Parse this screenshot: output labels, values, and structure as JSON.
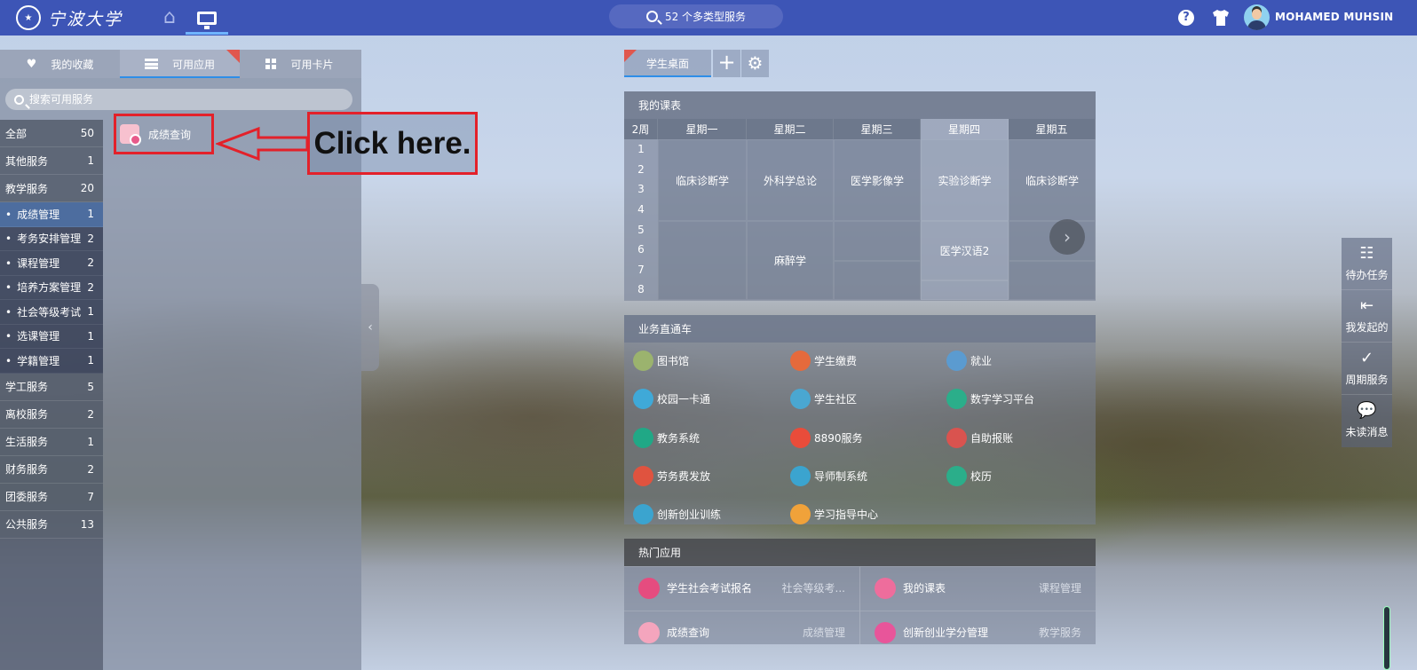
{
  "header": {
    "logo_text": "宁波大学",
    "search_label": "52 个多类型服务",
    "username": "MOHAMED MUHSIN",
    "help_glyph": "?"
  },
  "left_panel": {
    "tabs": [
      {
        "label": "我的收藏",
        "icon": "heart-icon"
      },
      {
        "label": "可用应用",
        "icon": "list-icon"
      },
      {
        "label": "可用卡片",
        "icon": "grid-icon"
      }
    ],
    "search_placeholder": "搜索可用服务",
    "categories": [
      {
        "label": "全部",
        "count": "50"
      },
      {
        "label": "其他服务",
        "count": "1"
      },
      {
        "label": "教学服务",
        "count": "20"
      }
    ],
    "subcategories": [
      {
        "label": "成绩管理",
        "count": "1"
      },
      {
        "label": "考务安排管理",
        "count": "2"
      },
      {
        "label": "课程管理",
        "count": "2"
      },
      {
        "label": "培养方案管理",
        "count": "2"
      },
      {
        "label": "社会等级考试",
        "count": "1"
      },
      {
        "label": "选课管理",
        "count": "1"
      },
      {
        "label": "学籍管理",
        "count": "1"
      }
    ],
    "categories_after": [
      {
        "label": "学工服务",
        "count": "5"
      },
      {
        "label": "离校服务",
        "count": "2"
      },
      {
        "label": "生活服务",
        "count": "1"
      },
      {
        "label": "财务服务",
        "count": "2"
      },
      {
        "label": "团委服务",
        "count": "7"
      },
      {
        "label": "公共服务",
        "count": "13"
      }
    ],
    "app_item": "成绩查询",
    "collapse_glyph": "‹",
    "subcategory_bullet": "•"
  },
  "annotation": {
    "text": "Click here."
  },
  "desk": {
    "tab": "学生桌面",
    "add_glyph": "+",
    "gear_glyph": "⚙"
  },
  "timetable": {
    "title": "我的课表",
    "week": "2周",
    "days": [
      "星期一",
      "星期二",
      "星期三",
      "星期四",
      "星期五"
    ],
    "periods": [
      "1",
      "2",
      "3",
      "4",
      "5",
      "6",
      "7",
      "8"
    ],
    "courses": {
      "mon1": "临床诊断学",
      "tue1": "外科学总论",
      "wed1": "医学影像学",
      "thu1": "实验诊断学",
      "fri1": "临床诊断学",
      "tue2": "麻醉学",
      "thu2": "医学汉语2"
    },
    "next_glyph": "›"
  },
  "business": {
    "title": "业务直通车",
    "items": [
      {
        "label": "图书馆",
        "color": "#9bb36e"
      },
      {
        "label": "学生缴费",
        "color": "#e56a3c"
      },
      {
        "label": "就业",
        "color": "#5b9bd0"
      },
      {
        "label": "校园一卡通",
        "color": "#3fa9d8"
      },
      {
        "label": "学生社区",
        "color": "#4aa7d1"
      },
      {
        "label": "数字学习平台",
        "color": "#2bae8a"
      },
      {
        "label": "教务系统",
        "color": "#20a886"
      },
      {
        "label": "8890服务",
        "color": "#e94c3a"
      },
      {
        "label": "自助报账",
        "color": "#d9534f"
      },
      {
        "label": "劳务费发放",
        "color": "#e0533f"
      },
      {
        "label": "导师制系统",
        "color": "#3ba4cf"
      },
      {
        "label": "校历",
        "color": "#2bae8a"
      },
      {
        "label": "创新创业训练",
        "color": "#3ba4cf"
      },
      {
        "label": "学习指导中心",
        "color": "#f0a23a"
      }
    ]
  },
  "hot": {
    "title": "热门应用",
    "items": [
      {
        "name": "学生社会考试报名",
        "category": "社会等级考...",
        "color": "#e54c7f"
      },
      {
        "name": "我的课表",
        "category": "课程管理",
        "color": "#ee6d9c"
      },
      {
        "name": "成绩查询",
        "category": "成绩管理",
        "color": "#f4a5bd"
      },
      {
        "name": "创新创业学分管理",
        "category": "教学服务",
        "color": "#e8559a"
      }
    ]
  },
  "float_menu": [
    {
      "label": "待办任务",
      "glyph": "☷"
    },
    {
      "label": "我发起的",
      "glyph": "⇤"
    },
    {
      "label": "周期服务",
      "glyph": "✓"
    },
    {
      "label": "未读消息",
      "glyph": "💬"
    }
  ]
}
